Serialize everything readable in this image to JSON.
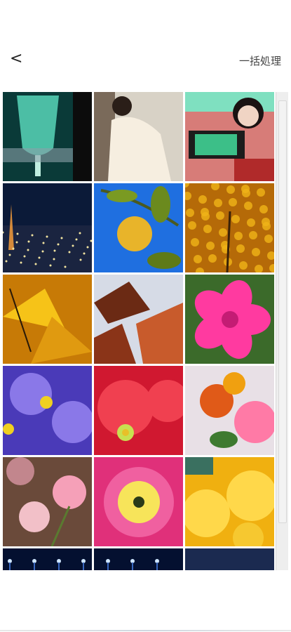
{
  "header": {
    "back_label": "<",
    "batch_label": "一括処理"
  },
  "photos": [
    {
      "name": "champagne-glass-photo",
      "colors": [
        "#0a3a38",
        "#58d6b8"
      ]
    },
    {
      "name": "woman-white-dress-photo",
      "colors": [
        "#d8d2c6",
        "#f6eee0"
      ]
    },
    {
      "name": "woman-game-console-photo",
      "colors": [
        "#d77c78",
        "#1e1a1a"
      ]
    },
    {
      "name": "tokyo-night-skyline-photo",
      "colors": [
        "#0b1a38",
        "#d48a3a"
      ]
    },
    {
      "name": "yuzu-fruit-blue-sky-photo",
      "colors": [
        "#1f6fe0",
        "#e8b42a"
      ]
    },
    {
      "name": "yellow-ginkgo-tree-photo",
      "colors": [
        "#b56a08",
        "#f0b418"
      ]
    },
    {
      "name": "ginkgo-leaves-photo",
      "colors": [
        "#c77a06",
        "#f6c318"
      ]
    },
    {
      "name": "red-autumn-leaves-photo",
      "colors": [
        "#6b2a14",
        "#c85b2c"
      ]
    },
    {
      "name": "pink-azalea-photo",
      "colors": [
        "#c41c74",
        "#ff3aa0"
      ]
    },
    {
      "name": "purple-primrose-photo",
      "colors": [
        "#4a3ab8",
        "#8a78e8"
      ]
    },
    {
      "name": "red-primrose-photo",
      "colors": [
        "#d01830",
        "#f04050"
      ]
    },
    {
      "name": "orange-pink-flowers-photo",
      "colors": [
        "#e05a18",
        "#ff7aa6"
      ]
    },
    {
      "name": "pink-clover-flowers-photo",
      "colors": [
        "#6a4a3a",
        "#f5a0b8"
      ]
    },
    {
      "name": "pink-primrose-closeup-photo",
      "colors": [
        "#e0307a",
        "#f7e45a"
      ]
    },
    {
      "name": "yellow-primrose-photo",
      "colors": [
        "#f0b010",
        "#ffd84a"
      ]
    },
    {
      "name": "night-street-photo-1",
      "colors": [
        "#041030",
        "#3a68c0"
      ]
    },
    {
      "name": "night-street-photo-2",
      "colors": [
        "#041030",
        "#3a68c0"
      ]
    },
    {
      "name": "night-sky-photo",
      "colors": [
        "#06102a",
        "#1b2a50"
      ]
    }
  ]
}
